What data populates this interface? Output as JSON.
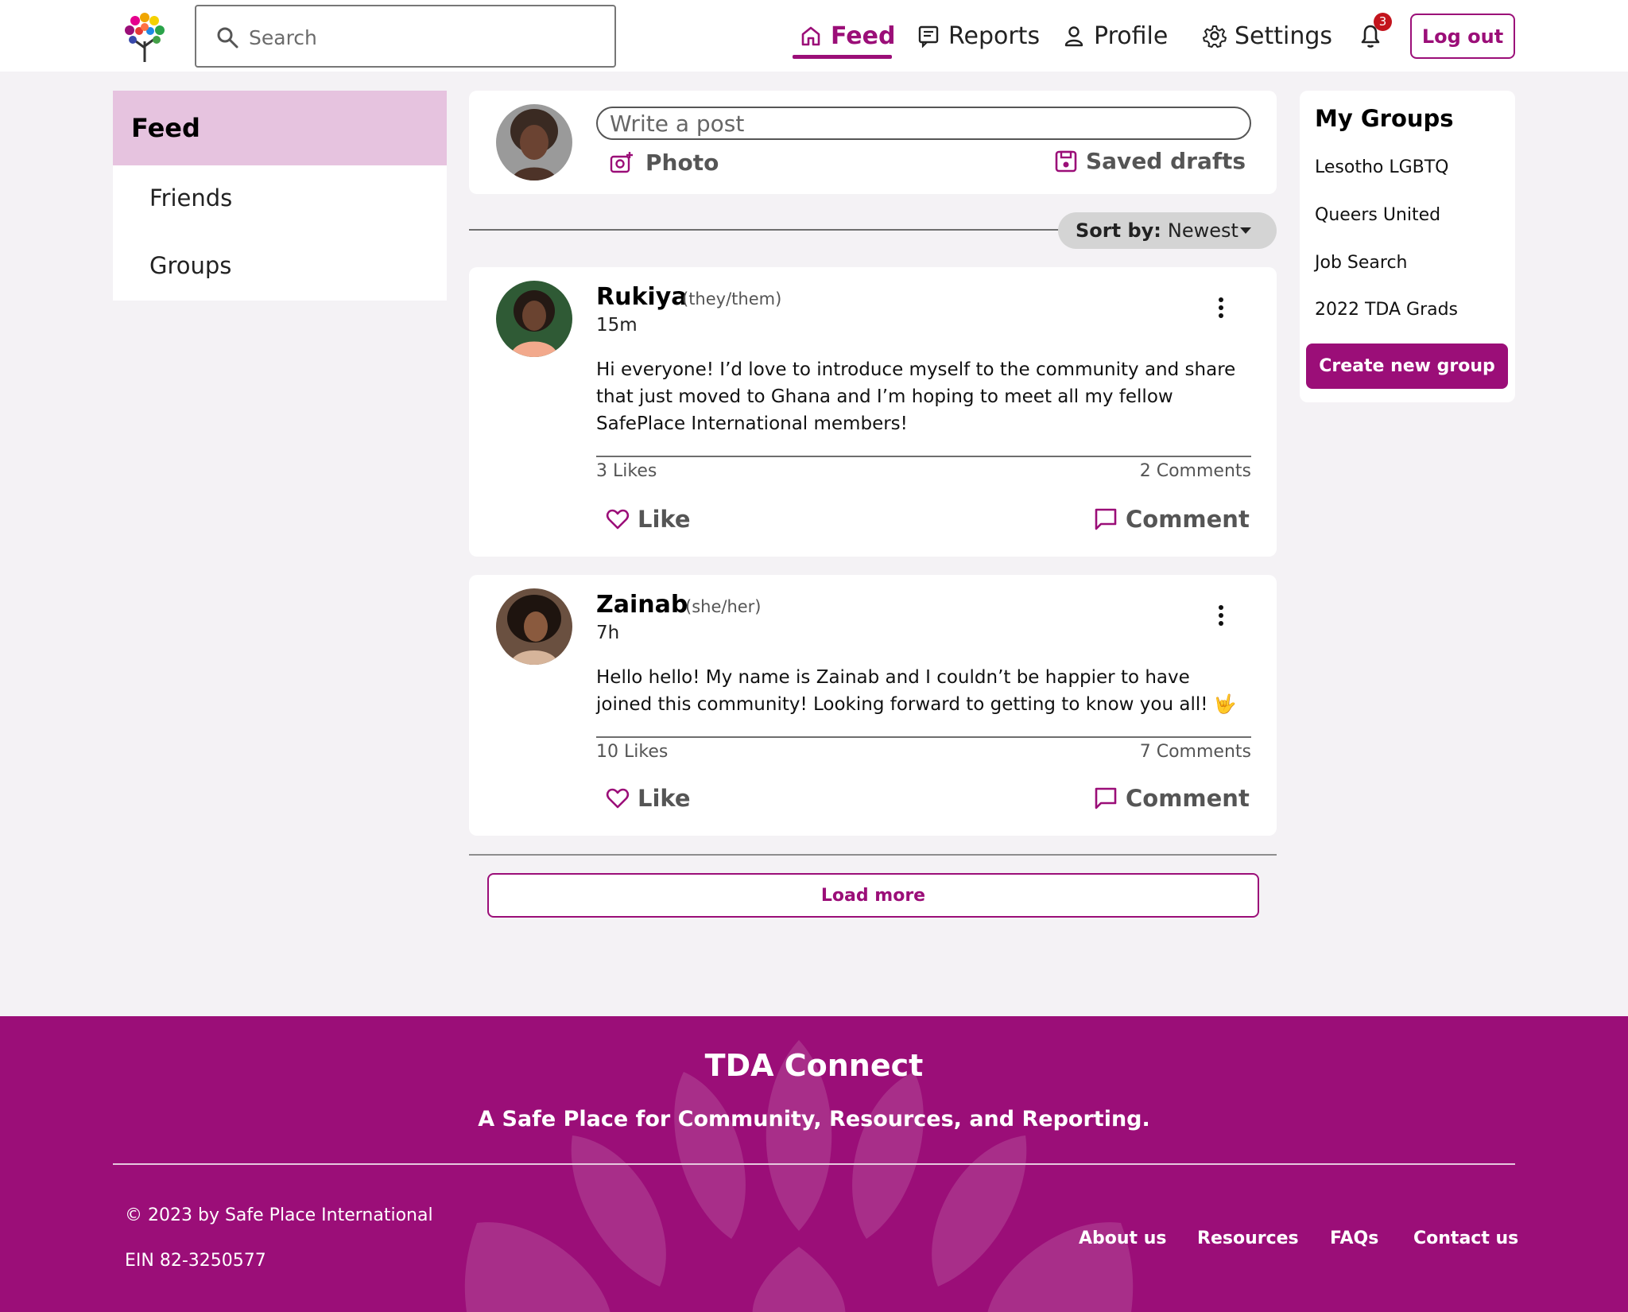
{
  "header": {
    "search_placeholder": "Search",
    "nav": {
      "feed": "Feed",
      "reports": "Reports",
      "profile": "Profile",
      "settings": "Settings"
    },
    "notification_count": "3",
    "logout_label": "Log out"
  },
  "sidebar": {
    "items": [
      {
        "label": "Feed",
        "active": true
      },
      {
        "label": "Friends",
        "active": false
      },
      {
        "label": "Groups",
        "active": false
      }
    ]
  },
  "composer": {
    "placeholder": "Write a post",
    "photo_label": "Photo",
    "drafts_label": "Saved drafts"
  },
  "sort": {
    "label": "Sort by:",
    "value": "Newest"
  },
  "posts": [
    {
      "name": "Rukiya",
      "pronouns": "(they/them)",
      "time": "15m",
      "body": "Hi everyone! I’d love to introduce myself to the community and share that just moved to Ghana and I’m hoping to meet all my fellow SafePlace International members!",
      "likes": "3 Likes",
      "comments": "2 Comments",
      "like_label": "Like",
      "comment_label": "Comment"
    },
    {
      "name": "Zainab",
      "pronouns": "(she/her)",
      "time": "7h",
      "body": "Hello hello! My name is Zainab and I couldn’t be happier to have joined this community! Looking forward to getting to know you all! 🤟",
      "likes": "10 Likes",
      "comments": "7 Comments",
      "like_label": "Like",
      "comment_label": "Comment"
    }
  ],
  "load_more_label": "Load more",
  "my_groups": {
    "title": "My Groups",
    "items": [
      "Lesotho LGBTQ",
      "Queers United",
      "Job Search",
      "2022 TDA Grads"
    ],
    "create_label": "Create new group"
  },
  "footer": {
    "title": "TDA Connect",
    "subtitle": "A Safe Place for Community, Resources, and Reporting.",
    "copyright": "© 2023 by Safe Place International",
    "ein": "EIN 82-3250577",
    "links": [
      "About us",
      "Resources",
      "FAQs",
      "Contact us"
    ]
  },
  "colors": {
    "brand": "#9b0e78",
    "active_tab_bg": "#e6c3df",
    "page_bg": "#f4f2f5",
    "badge": "#c3141d"
  },
  "icons": {
    "search": "search-icon",
    "home": "home-icon",
    "reports": "reports-icon",
    "profile": "person-icon",
    "settings": "gear-icon",
    "notifications": "bell-icon",
    "photo": "add-photo-icon",
    "drafts": "save-icon",
    "like": "heart-icon",
    "comment": "comment-icon",
    "more": "more-vertical-icon"
  }
}
